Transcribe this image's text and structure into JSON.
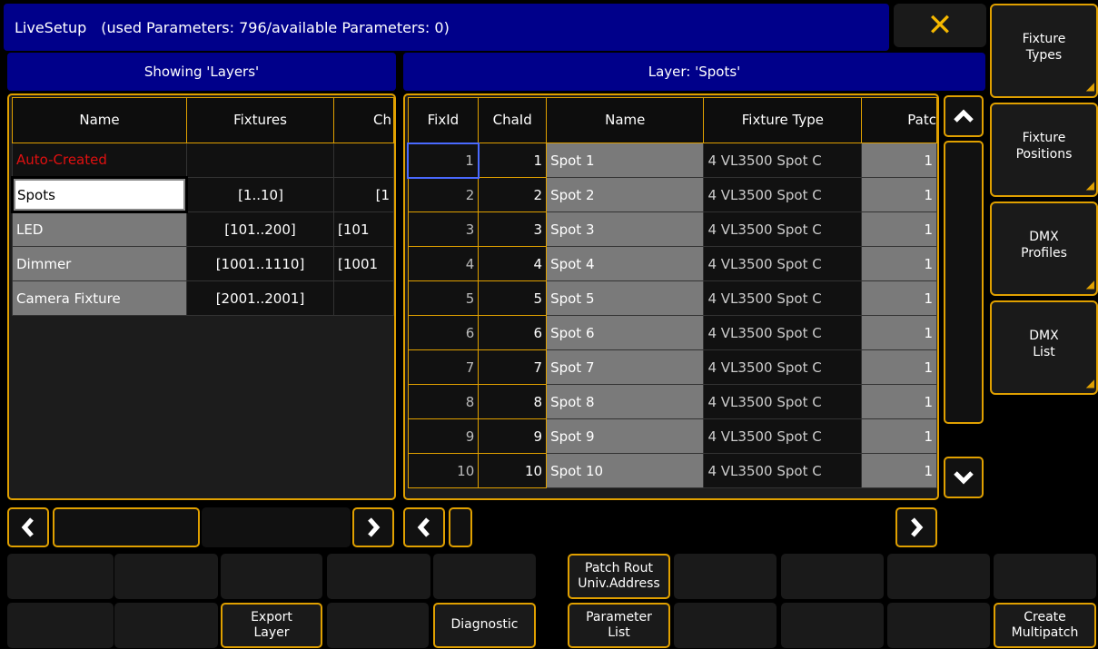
{
  "title": {
    "app": "LiveSetup",
    "params": "(used Parameters: 796/available Parameters: 0)"
  },
  "close_glyph": "✕",
  "left_header": "Showing 'Layers'",
  "right_header": "Layer: 'Spots'",
  "layers": {
    "columns": [
      "Name",
      "Fixtures",
      "Ch"
    ],
    "rows": [
      {
        "name": "Auto-Created",
        "fixtures": "",
        "ch": ""
      },
      {
        "name": "Spots",
        "fixtures": "[1..10]",
        "ch": "[1"
      },
      {
        "name": "LED",
        "fixtures": "[101..200]",
        "ch": "[101"
      },
      {
        "name": "Dimmer",
        "fixtures": "[1001..1110]",
        "ch": "[1001"
      },
      {
        "name": "Camera Fixture",
        "fixtures": "[2001..2001]",
        "ch": ""
      }
    ]
  },
  "fixtures": {
    "columns": [
      "FixId",
      "ChaId",
      "Name",
      "Fixture Type",
      "Patc"
    ],
    "rows": [
      {
        "fixid": "1",
        "chaid": "1",
        "name": "Spot 1",
        "type": "4 VL3500 Spot C",
        "patch": "1"
      },
      {
        "fixid": "2",
        "chaid": "2",
        "name": "Spot 2",
        "type": "4 VL3500 Spot C",
        "patch": "1"
      },
      {
        "fixid": "3",
        "chaid": "3",
        "name": "Spot 3",
        "type": "4 VL3500 Spot C",
        "patch": "1"
      },
      {
        "fixid": "4",
        "chaid": "4",
        "name": "Spot 4",
        "type": "4 VL3500 Spot C",
        "patch": "1"
      },
      {
        "fixid": "5",
        "chaid": "5",
        "name": "Spot 5",
        "type": "4 VL3500 Spot C",
        "patch": "1"
      },
      {
        "fixid": "6",
        "chaid": "6",
        "name": "Spot 6",
        "type": "4 VL3500 Spot C",
        "patch": "1"
      },
      {
        "fixid": "7",
        "chaid": "7",
        "name": "Spot 7",
        "type": "4 VL3500 Spot C",
        "patch": "1"
      },
      {
        "fixid": "8",
        "chaid": "8",
        "name": "Spot 8",
        "type": "4 VL3500 Spot C",
        "patch": "1"
      },
      {
        "fixid": "9",
        "chaid": "9",
        "name": "Spot 9",
        "type": "4 VL3500 Spot C",
        "patch": "1"
      },
      {
        "fixid": "10",
        "chaid": "10",
        "name": "Spot 10",
        "type": "4 VL3500 Spot C",
        "patch": "1"
      }
    ]
  },
  "side_buttons": [
    {
      "line1": "Fixture",
      "line2": "Types"
    },
    {
      "line1": "Fixture",
      "line2": "Positions"
    },
    {
      "line1": "DMX",
      "line2": "Profiles"
    },
    {
      "line1": "DMX",
      "line2": "List"
    }
  ],
  "bottom": {
    "patch_rout": {
      "line1": "Patch Rout",
      "line2": "Univ.Address"
    },
    "export_layer": {
      "line1": "Export",
      "line2": "Layer"
    },
    "diagnostic": "Diagnostic",
    "parameter_list": {
      "line1": "Parameter",
      "line2": "List"
    },
    "create_multipatch": {
      "line1": "Create",
      "line2": "Multipatch"
    }
  },
  "colors": {
    "accent": "#e0a000",
    "header_blue": "#00008a",
    "auto_created_red": "#e01010"
  }
}
